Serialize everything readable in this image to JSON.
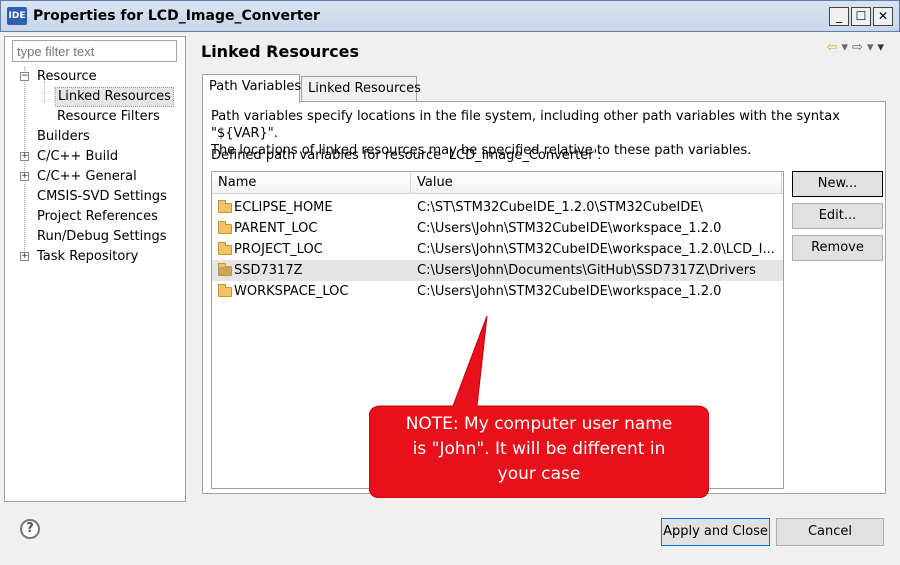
{
  "window": {
    "icon_label": "IDE",
    "title": "Properties for LCD_Image_Converter",
    "minimize": "_",
    "maximize": "☐",
    "close": "✕"
  },
  "filter": {
    "placeholder": "type filter text"
  },
  "tree": [
    {
      "label": "Resource",
      "expander": "−",
      "level": 0
    },
    {
      "label": "Linked Resources",
      "level": 1,
      "selected": true
    },
    {
      "label": "Resource Filters",
      "level": 1
    },
    {
      "label": "Builders",
      "level": 0
    },
    {
      "label": "C/C++ Build",
      "expander": "+",
      "level": 0
    },
    {
      "label": "C/C++ General",
      "expander": "+",
      "level": 0
    },
    {
      "label": "CMSIS-SVD Settings",
      "level": 0
    },
    {
      "label": "Project References",
      "level": 0
    },
    {
      "label": "Run/Debug Settings",
      "level": 0
    },
    {
      "label": "Task Repository",
      "expander": "+",
      "level": 0
    }
  ],
  "page": {
    "title": "Linked Resources",
    "tabs": [
      {
        "label": "Path Variables",
        "active": true
      },
      {
        "label": "Linked Resources",
        "active": false
      }
    ],
    "description_line1": "Path variables specify locations in the file system, including other path variables with the syntax \"${VAR}\".",
    "description_line2": "The locations of linked resources may be specified relative to these path variables.",
    "defined_label": "Defined path variables for resource 'LCD_Image_Converter':"
  },
  "table": {
    "columns": [
      "Name",
      "Value"
    ],
    "rows": [
      {
        "name": "ECLIPSE_HOME",
        "value": "C:\\ST\\STM32CubeIDE_1.2.0\\STM32CubeIDE\\"
      },
      {
        "name": "PARENT_LOC",
        "value": "C:\\Users\\John\\STM32CubeIDE\\workspace_1.2.0"
      },
      {
        "name": "PROJECT_LOC",
        "value": "C:\\Users\\John\\STM32CubeIDE\\workspace_1.2.0\\LCD_I..."
      },
      {
        "name": "SSD7317Z",
        "value": "C:\\Users\\John\\Documents\\GitHub\\SSD7317Z\\Drivers",
        "selected": true
      },
      {
        "name": "WORKSPACE_LOC",
        "value": "C:\\Users\\John\\STM32CubeIDE\\workspace_1.2.0"
      }
    ]
  },
  "side_buttons": {
    "new": "New...",
    "edit": "Edit...",
    "remove": "Remove"
  },
  "callout": {
    "line1": "NOTE: My computer user name",
    "line2": "is \"John\". It will be different in",
    "line3": "your case",
    "color": "#e8101a"
  },
  "footer": {
    "help": "?",
    "apply_close": "Apply and Close",
    "cancel": "Cancel"
  }
}
